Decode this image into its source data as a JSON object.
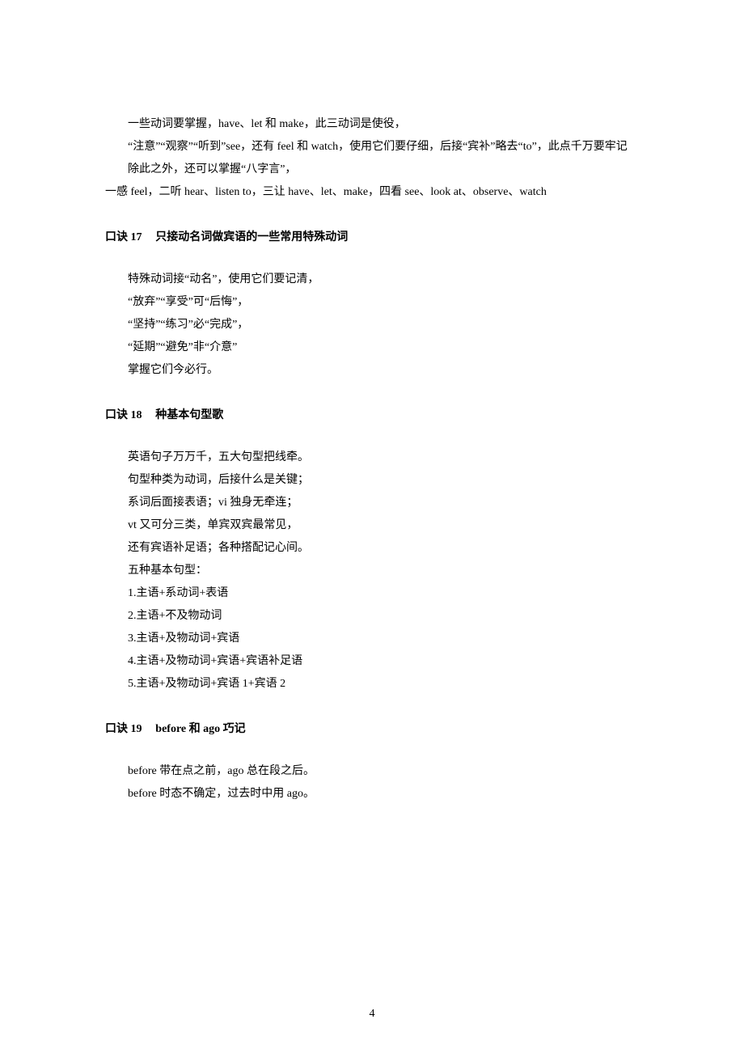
{
  "section16": {
    "line1": "一些动词要掌握，have、let 和 make，此三动词是使役，",
    "line2": "“注意”“观察”“听到”see，还有 feel 和 watch，使用它们要仔细，后接“宾补”略去“to”，此点千万要牢记",
    "line3": "除此之外，还可以掌握“八字言”，",
    "line4": "一感 feel，二听 hear、listen to，三让 have、let、make，四看 see、look at、observe、watch"
  },
  "section17": {
    "headingLabel": "口诀 17",
    "headingTitle": "只接动名词做宾语的一些常用特殊动词",
    "line1": "特殊动词接“动名”，使用它们要记清，",
    "line2": "“放弃”“享受”可“后悔”，",
    "line3": "“坚持”“练习”必“完成”，",
    "line4": "“延期”“避免”非“介意”",
    "line5": "掌握它们今必行。"
  },
  "section18": {
    "headingLabel": "口诀 18",
    "headingTitle": "种基本句型歌",
    "line1": "英语句子万万千，五大句型把线牵。",
    "line2": "句型种类为动词，后接什么是关键；",
    "line3": "系词后面接表语；vi 独身无牵连；",
    "line4": "vt 又可分三类，单宾双宾最常见，",
    "line5": "还有宾语补足语；各种搭配记心间。",
    "line6": "五种基本句型：",
    "line7": "1.主语+系动词+表语",
    "line8": "2.主语+不及物动词",
    "line9": "3.主语+及物动词+宾语",
    "line10": "4.主语+及物动词+宾语+宾语补足语",
    "line11": "5.主语+及物动词+宾语 1+宾语 2"
  },
  "section19": {
    "headingLabel": "口诀 19",
    "headingTitle": "before 和 ago 巧记",
    "line1": "before 带在点之前，ago 总在段之后。",
    "line2": "before 时态不确定，过去时中用 ago。"
  },
  "pageNumber": "4"
}
